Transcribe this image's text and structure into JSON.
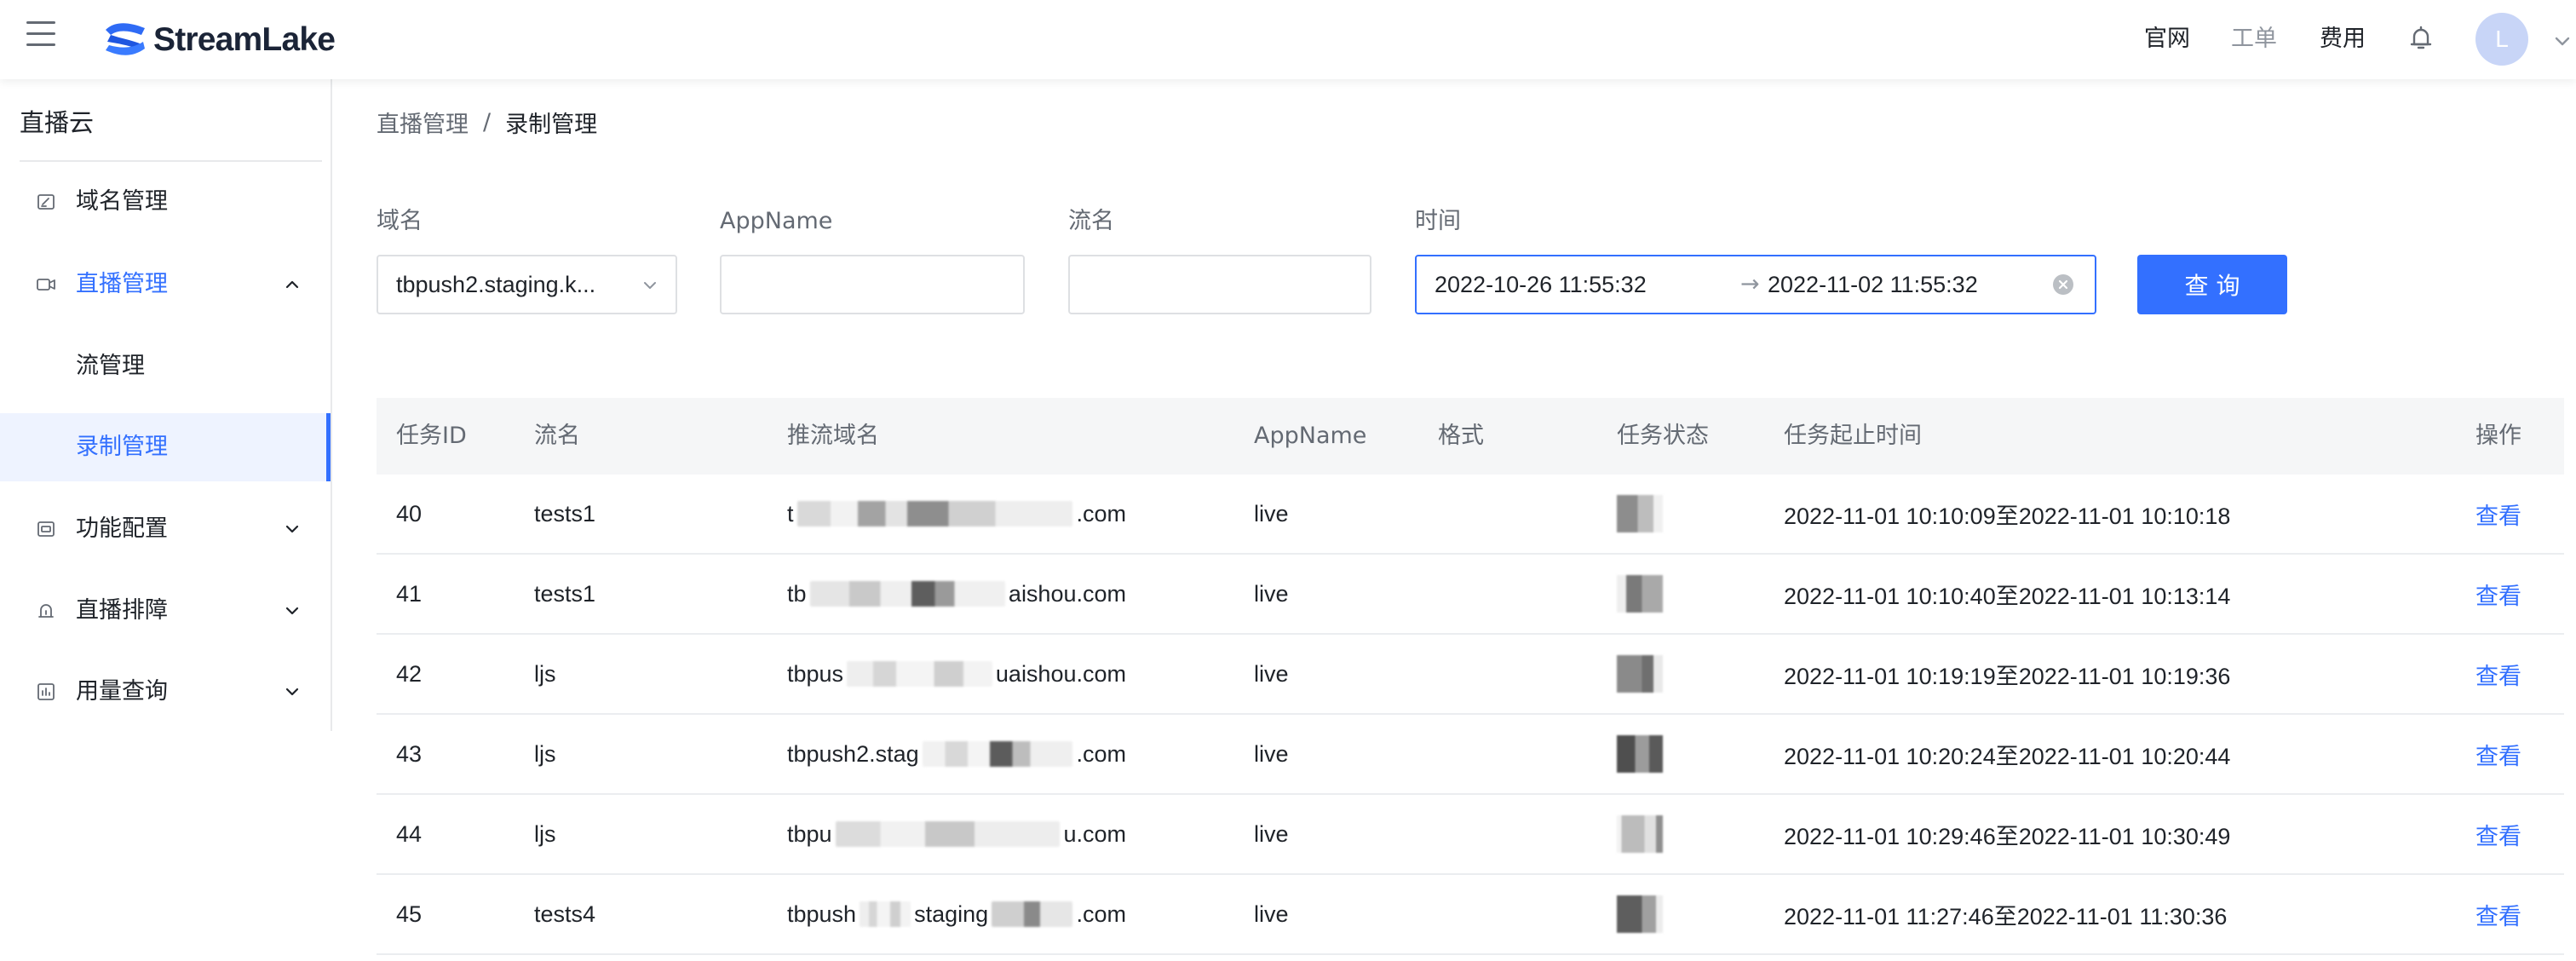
{
  "header": {
    "brand": "StreamLake",
    "nav": [
      {
        "label": "官网",
        "color": "#1F2329"
      },
      {
        "label": "工单",
        "color": "#8F959E"
      },
      {
        "label": "费用",
        "color": "#1F2329"
      }
    ],
    "avatar_initial": "L",
    "icons": {
      "menu": "hamburger-icon",
      "logo": "streamlake-logo-icon",
      "notifications": "bell-icon",
      "account_menu": "chevron-down-icon"
    }
  },
  "sidebar": {
    "title": "直播云",
    "items": [
      {
        "label": "域名管理",
        "icon": "domain-edit-icon"
      },
      {
        "label": "直播管理",
        "icon": "video-camera-icon",
        "expanded": true
      },
      {
        "label": "流管理"
      },
      {
        "label": "录制管理",
        "selected": true
      },
      {
        "label": "功能配置",
        "icon": "feature-config-icon",
        "expanded": false
      },
      {
        "label": "直播排障",
        "icon": "troubleshoot-icon",
        "expanded": false
      },
      {
        "label": "用量查询",
        "icon": "usage-chart-icon",
        "expanded": false
      }
    ]
  },
  "breadcrumb": {
    "parent": "直播管理",
    "separator": "/",
    "current": "录制管理"
  },
  "filters": {
    "domain": {
      "label": "域名",
      "value": "tbpush2.staging.k..."
    },
    "app_name": {
      "label": "AppName"
    },
    "stream_name": {
      "label": "流名"
    },
    "time": {
      "label": "时间",
      "start": "2022-10-26 11:55:32",
      "separator": "→",
      "end": "2022-11-02 11:55:32"
    },
    "query_button": "查 询"
  },
  "table": {
    "columns": [
      "任务ID",
      "流名",
      "推流域名",
      "AppName",
      "格式",
      "任务状态",
      "任务起止时间",
      "操作"
    ],
    "rows": [
      {
        "id": "40",
        "stream": "tests1",
        "domain_prefix": "t",
        "domain_suffix": ".com",
        "app": "live",
        "time_range": "2022-11-01 10:10:09至2022-11-01 10:10:18",
        "action": "查看"
      },
      {
        "id": "41",
        "stream": "tests1",
        "domain_prefix": "tb",
        "domain_suffix": "aishou.com",
        "app": "live",
        "time_range": "2022-11-01 10:10:40至2022-11-01 10:13:14",
        "action": "查看"
      },
      {
        "id": "42",
        "stream": "ljs",
        "domain_prefix": "tbpus",
        "domain_suffix": "uaishou.com",
        "app": "live",
        "time_range": "2022-11-01 10:19:19至2022-11-01 10:19:36",
        "action": "查看"
      },
      {
        "id": "43",
        "stream": "ljs",
        "domain_prefix": "tbpush2.stag",
        "domain_suffix": ".com",
        "app": "live",
        "time_range": "2022-11-01 10:20:24至2022-11-01 10:20:44",
        "action": "查看"
      },
      {
        "id": "44",
        "stream": "ljs",
        "domain_prefix": "tbpu",
        "domain_suffix": "u.com",
        "app": "live",
        "time_range": "2022-11-01 10:29:46至2022-11-01 10:30:49",
        "action": "查看"
      },
      {
        "id": "45",
        "stream": "tests4",
        "domain_prefix": "tbpush",
        "domain_middle": "staging",
        "domain_suffix": ".com",
        "app": "live",
        "time_range": "2022-11-01 11:27:46至2022-11-01 11:30:36",
        "action": "查看"
      }
    ]
  },
  "colors": {
    "primary": "#3370FF",
    "text": "#1F2329",
    "secondary_text": "#646A73",
    "muted_text": "#8F959E",
    "table_header_bg": "#F5F6F7",
    "selected_menu_bg": "#EEF3FF",
    "avatar_bg": "#C8D5F7"
  }
}
